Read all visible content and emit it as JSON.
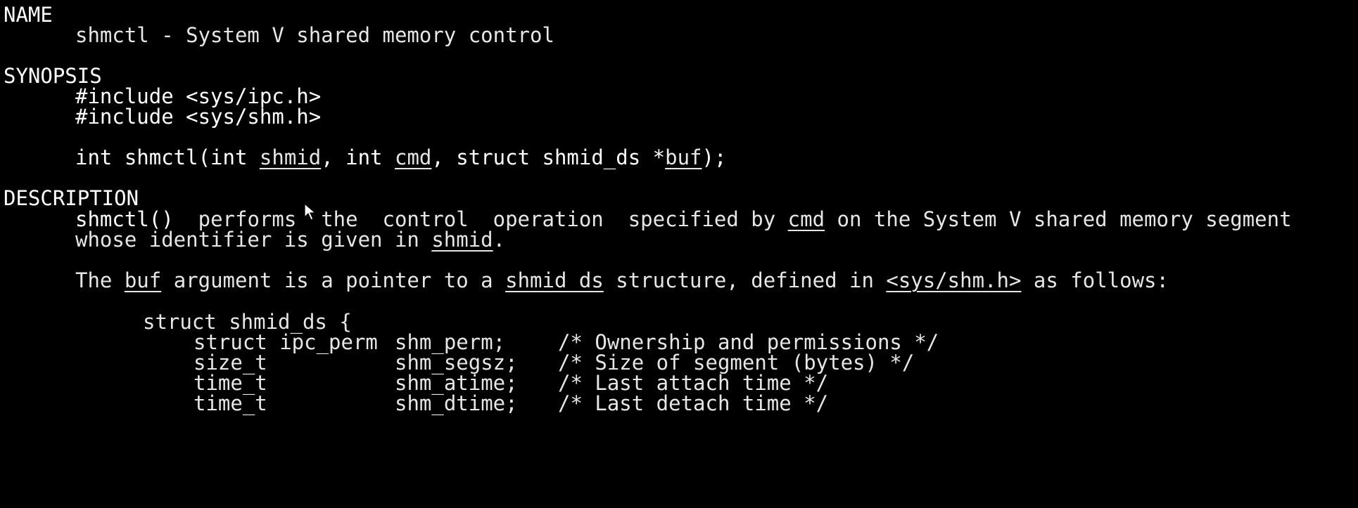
{
  "man_page": {
    "name_heading": "NAME",
    "name_line": "shmctl - System V shared memory control",
    "synopsis_heading": "SYNOPSIS",
    "include_1": "#include <sys/ipc.h>",
    "include_2": "#include <sys/shm.h>",
    "prototype": {
      "p1": "int shmctl(int ",
      "arg_shmid": "shmid",
      "p2": ", int ",
      "arg_cmd": "cmd",
      "p3": ", struct shmid_ds *",
      "arg_buf": "buf",
      "p4": ");"
    },
    "description_heading": "DESCRIPTION",
    "desc_line1": {
      "fn": "shmctl()",
      "t1": "  performs  the  control  operation  specified by ",
      "ref_cmd": "cmd",
      "t2": " on the System V shared memory segment"
    },
    "desc_line2": {
      "t1": "whose identifier is given in ",
      "ref_shmid": "shmid",
      "t2": "."
    },
    "desc_line3": {
      "t1": "The ",
      "ref_buf": "buf",
      "t2": " argument is a pointer to a ",
      "ref_shmid_ds": "shmid_ds",
      "t3": " structure, defined in ",
      "ref_header": "<sys/shm.h>",
      "t4": " as follows:"
    },
    "struct_open": "struct shmid_ds {",
    "struct_fields": [
      {
        "type": "struct ipc_perm",
        "name": "shm_perm;",
        "comment": "/* Ownership and permissions */"
      },
      {
        "type": "size_t",
        "name": "shm_segsz;",
        "comment": "/* Size of segment (bytes) */"
      },
      {
        "type": "time_t",
        "name": "shm_atime;",
        "comment": "/* Last attach time */"
      },
      {
        "type": "time_t",
        "name": "shm_dtime;",
        "comment": "/* Last detach time */"
      }
    ]
  },
  "colors": {
    "background": "#000000",
    "text": "#e6e6e6",
    "bold": "#ffffff"
  },
  "icons": {
    "mouse_cursor": "arrow-cursor-icon"
  }
}
